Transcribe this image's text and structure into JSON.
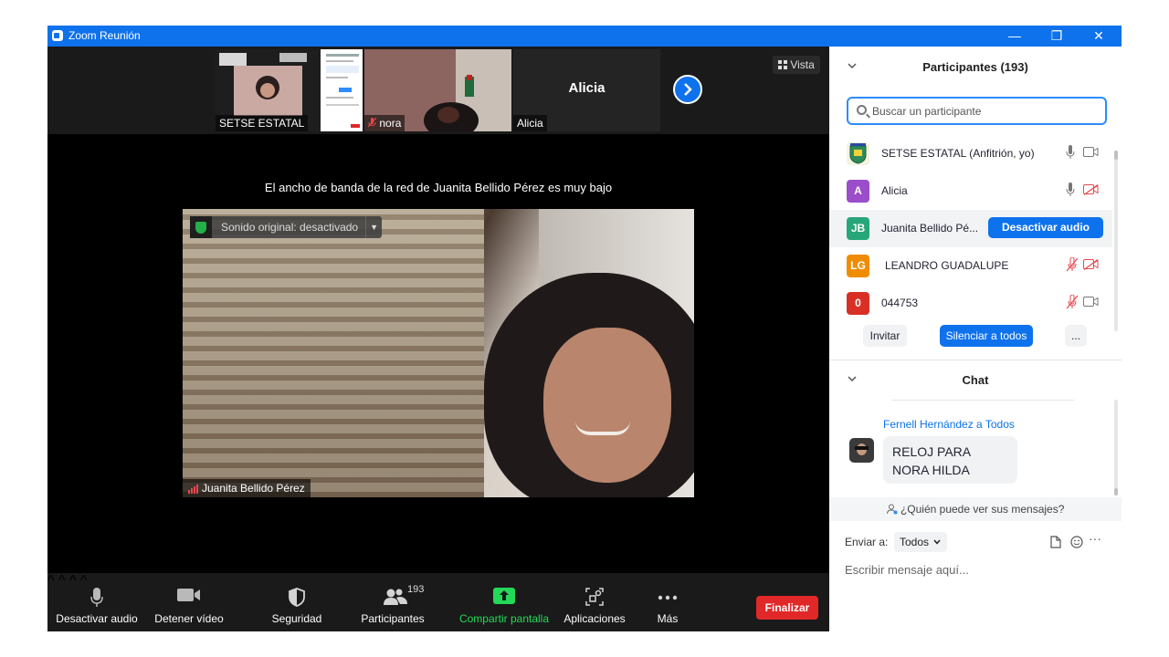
{
  "window": {
    "title": "Zoom Reunión",
    "controls": {
      "minimize": "—",
      "restore": "❐",
      "close": "✕"
    }
  },
  "strip": {
    "thumbnails": [
      {
        "name": "SETSE ESTATAL"
      },
      {
        "name": "nora",
        "muted": true
      },
      {
        "name": "Alicia",
        "big_label": "Alicia"
      }
    ],
    "next_icon": "chevron-right-icon",
    "view_label": "Vista"
  },
  "main": {
    "bandwidth_warning": "El ancho de banda de la red de Juanita Bellido Pérez es muy bajo",
    "original_sound": "Sonido original: desactivado",
    "speaker_name": "Juanita Bellido Pérez"
  },
  "toolbar": {
    "items": [
      {
        "label": "Desactivar audio",
        "icon": "microphone-icon"
      },
      {
        "label": "Detener vídeo",
        "icon": "video-camera-icon"
      },
      {
        "label": "Seguridad",
        "icon": "shield-icon"
      },
      {
        "label": "Participantes",
        "icon": "participants-icon",
        "count": "193"
      },
      {
        "label": "Compartir pantalla",
        "icon": "share-screen-icon",
        "color": "#23d959"
      },
      {
        "label": "Aplicaciones",
        "icon": "apps-icon"
      },
      {
        "label": "Más",
        "icon": "more-dots-icon"
      }
    ],
    "end_label": "Finalizar",
    "end_color": "#e02828"
  },
  "participants": {
    "title": "Participantes (193)",
    "search_placeholder": "Buscar un participante",
    "list": [
      {
        "initials": "",
        "name": "SETSE ESTATAL (Anfitrión, yo)",
        "mic": "on",
        "cam": "on"
      },
      {
        "initials": "A",
        "name": "Alicia",
        "color": "#9b4dca",
        "mic": "on",
        "cam": "off"
      },
      {
        "initials": "JB",
        "name": "Juanita Bellido Pé...",
        "color": "#27a67a",
        "action": "Desactivar audio"
      },
      {
        "initials": "LG",
        "name": "LEANDRO GUADALUPE",
        "color": "#f08c00",
        "mic": "muted",
        "cam": "off"
      },
      {
        "initials": "0",
        "name": "044753",
        "color": "#d93025",
        "mic": "muted",
        "cam": "on"
      }
    ],
    "invite_label": "Invitar",
    "mute_all_label": "Silenciar a todos",
    "more_label": "..."
  },
  "chat": {
    "title": "Chat",
    "messages": [
      {
        "sender": "Fernell Hernández a Todos",
        "text": "RELOJ PARA NORA HILDA"
      }
    ],
    "who_can_see": "¿Quién puede ver sus mensajes?",
    "send_to_label": "Enviar a:",
    "send_to_value": "Todos",
    "input_placeholder": "Escribir mensaje aquí..."
  },
  "colors": {
    "accent": "#0e72ed",
    "toolbar_bg": "#1a1a1a",
    "muted_red": "#e8474b"
  }
}
